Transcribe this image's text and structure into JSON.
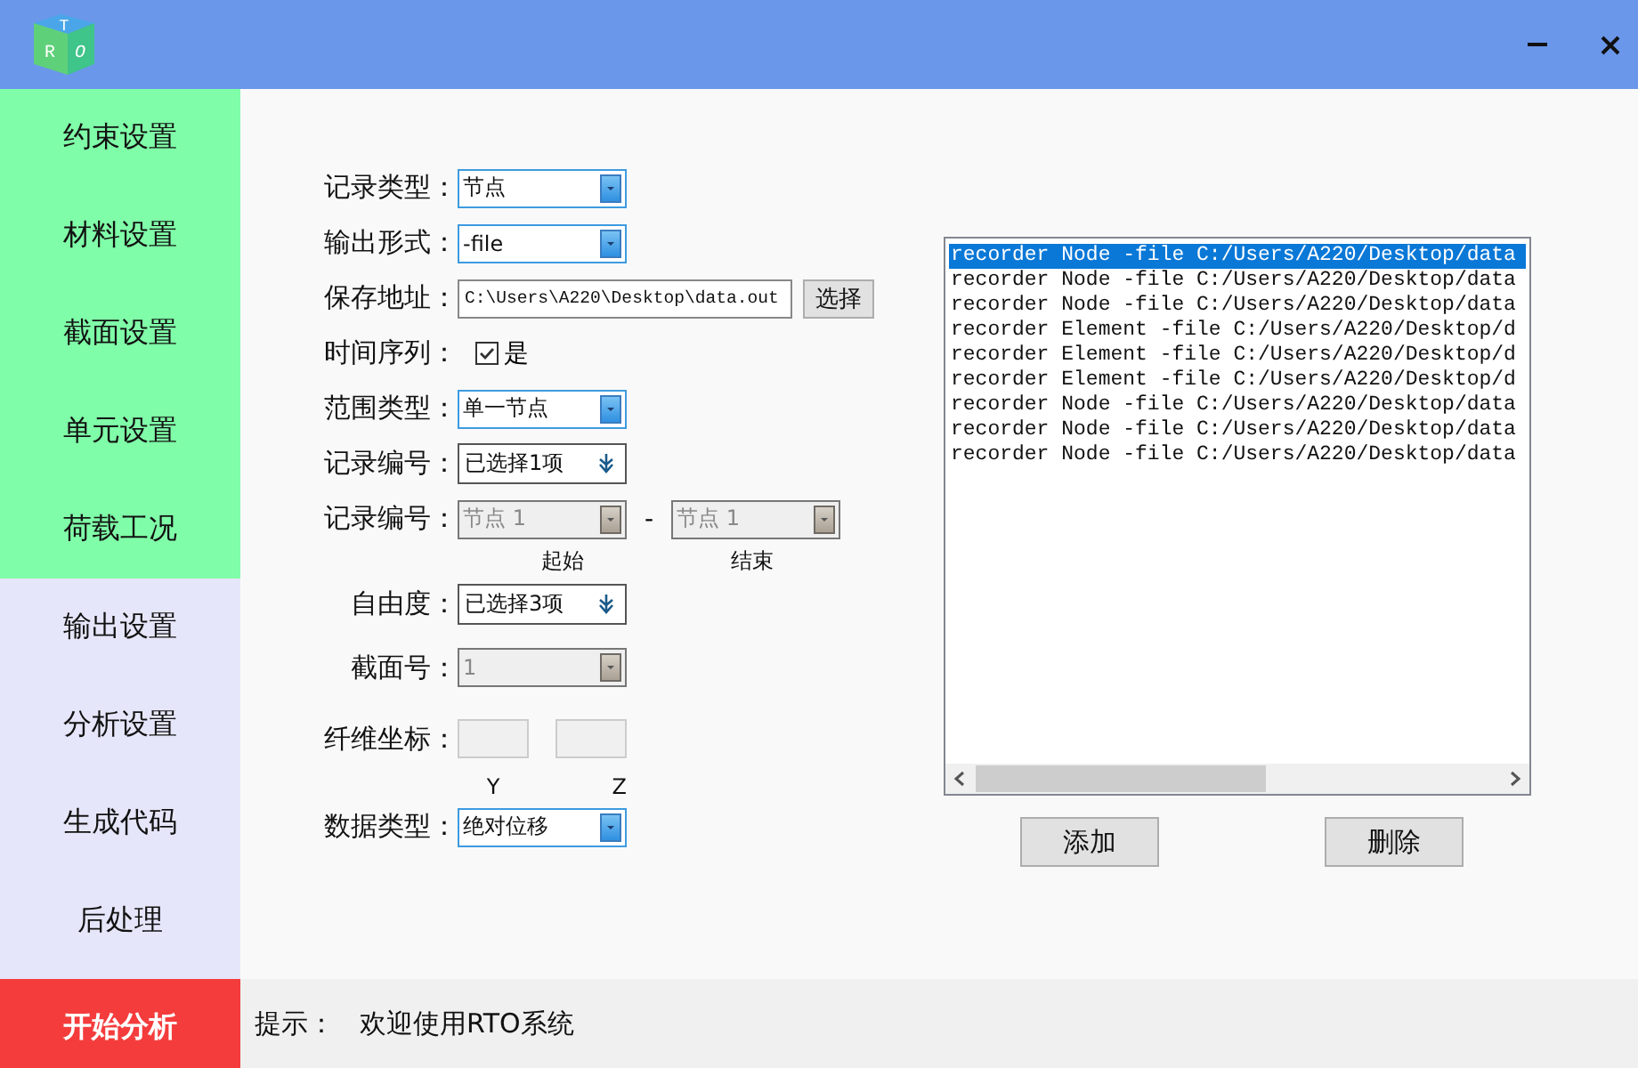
{
  "window": {
    "logo_letters": [
      "T",
      "R",
      "O"
    ]
  },
  "sidebar": {
    "items": [
      {
        "label": "约束设置",
        "color": "#80fda8"
      },
      {
        "label": "材料设置",
        "color": "#80fda8"
      },
      {
        "label": "截面设置",
        "color": "#80fda8"
      },
      {
        "label": "单元设置",
        "color": "#80fda8"
      },
      {
        "label": "荷载工况",
        "color": "#80fda8"
      },
      {
        "label": "输出设置",
        "color": "#e6e6fa"
      },
      {
        "label": "分析设置",
        "color": "#e6e6fa"
      },
      {
        "label": "生成代码",
        "color": "#e6e6fa"
      },
      {
        "label": "后处理",
        "color": "#e6e6fa"
      }
    ],
    "start_button": {
      "label": "开始分析",
      "color": "#f43c3c"
    }
  },
  "form": {
    "fields": [
      {
        "kind": "combo",
        "label": "记录类型：",
        "value": "节点",
        "disabled": false
      },
      {
        "kind": "combo",
        "label": "输出形式：",
        "value": "-file",
        "disabled": false
      },
      {
        "kind": "path",
        "label": "保存地址：",
        "value": "C:\\Users\\A220\\Desktop\\data.out",
        "button": "选择"
      },
      {
        "kind": "checkbox",
        "label": "时间序列：",
        "text": "是",
        "checked": true
      },
      {
        "kind": "combo",
        "label": "范围类型：",
        "value": "单一节点",
        "disabled": false
      },
      {
        "kind": "multiselect",
        "label": "记录编号：",
        "value": "已选择1项"
      },
      {
        "kind": "range",
        "label": "记录编号：",
        "separator": "-",
        "ends": [
          {
            "value": "节点 1",
            "caption": "起始",
            "disabled": true
          },
          {
            "value": "节点 1",
            "caption": "结束",
            "disabled": true
          }
        ]
      },
      {
        "kind": "multiselect",
        "label": "自由度：",
        "value": "已选择3项"
      },
      {
        "kind": "combo",
        "label": "截面号：",
        "value": "1",
        "disabled": true
      },
      {
        "kind": "pair",
        "label": "纤维坐标：",
        "inputs": [
          {
            "caption": "Y",
            "disabled": true
          },
          {
            "caption": "Z",
            "disabled": true
          }
        ]
      },
      {
        "kind": "combo",
        "label": "数据类型：",
        "value": "绝对位移",
        "disabled": false
      }
    ]
  },
  "command_list": {
    "items": [
      {
        "text": "recorder Node -file C:/Users/A220/Desktop/data",
        "selected": true
      },
      {
        "text": "recorder Node -file C:/Users/A220/Desktop/data",
        "selected": false
      },
      {
        "text": "recorder Node -file C:/Users/A220/Desktop/data",
        "selected": false
      },
      {
        "text": "recorder Element -file C:/Users/A220/Desktop/d",
        "selected": false
      },
      {
        "text": "recorder Element -file C:/Users/A220/Desktop/d",
        "selected": false
      },
      {
        "text": "recorder Element -file C:/Users/A220/Desktop/d",
        "selected": false
      },
      {
        "text": "recorder Node -file C:/Users/A220/Desktop/data",
        "selected": false
      },
      {
        "text": "recorder Node -file C:/Users/A220/Desktop/data",
        "selected": false
      },
      {
        "text": "recorder Node -file C:/Users/A220/Desktop/data",
        "selected": false
      }
    ],
    "buttons": [
      "添加",
      "删除"
    ]
  },
  "status_bar": {
    "label": "提示：",
    "message": "欢迎使用RTO系统"
  }
}
